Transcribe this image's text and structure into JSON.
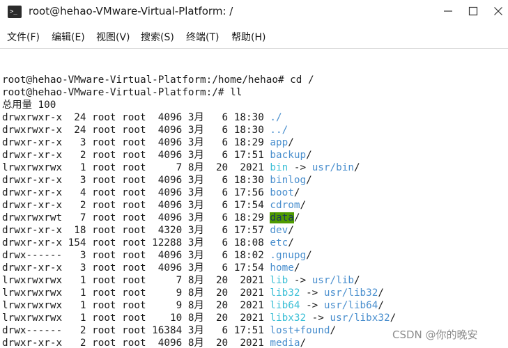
{
  "window": {
    "title": "root@hehao-VMware-Virtual-Platform: /",
    "icon": "terminal-icon",
    "controls": [
      "minimize-icon",
      "maximize-icon",
      "close-icon"
    ]
  },
  "menu": [
    {
      "label": "文件(F)"
    },
    {
      "label": "编辑(E)"
    },
    {
      "label": "视图(V)"
    },
    {
      "label": "搜索(S)"
    },
    {
      "label": "终端(T)"
    },
    {
      "label": "帮助(H)"
    }
  ],
  "terminal": {
    "lines": [
      {
        "text": "root@hehao-VMware-Virtual-Platform:/home/hehao# cd /"
      },
      {
        "text": "root@hehao-VMware-Virtual-Platform:/# ll"
      },
      {
        "text": "总用量 100"
      }
    ],
    "entries": [
      {
        "meta": "drwxrwxr-x  24 root root  4096 3月   6 18:30 ",
        "name": "./",
        "kind": "dir",
        "suffix": "",
        "target": ""
      },
      {
        "meta": "drwxrwxr-x  24 root root  4096 3月   6 18:30 ",
        "name": "../",
        "kind": "dir",
        "suffix": "",
        "target": ""
      },
      {
        "meta": "drwxr-xr-x   3 root root  4096 3月   6 18:29 ",
        "name": "app",
        "kind": "dir",
        "suffix": "/",
        "target": ""
      },
      {
        "meta": "drwxr-xr-x   2 root root  4096 3月   6 17:51 ",
        "name": "backup",
        "kind": "dir",
        "suffix": "/",
        "target": ""
      },
      {
        "meta": "lrwxrwxrwx   1 root root     7 8月  20  2021 ",
        "name": "bin",
        "kind": "link",
        "suffix": " -> ",
        "target": "usr/bin"
      },
      {
        "meta": "drwxr-xr-x   3 root root  4096 3月   6 18:30 ",
        "name": "binlog",
        "kind": "dir",
        "suffix": "/",
        "target": ""
      },
      {
        "meta": "drwxr-xr-x   4 root root  4096 3月   6 17:56 ",
        "name": "boot",
        "kind": "dir",
        "suffix": "/",
        "target": ""
      },
      {
        "meta": "drwxr-xr-x   2 root root  4096 3月   6 17:54 ",
        "name": "cdrom",
        "kind": "dir",
        "suffix": "/",
        "target": ""
      },
      {
        "meta": "drwxrwxrwt   7 root root  4096 3月   6 18:29 ",
        "name": "data",
        "kind": "sticky",
        "suffix": "/",
        "target": ""
      },
      {
        "meta": "drwxr-xr-x  18 root root  4320 3月   6 17:57 ",
        "name": "dev",
        "kind": "dir",
        "suffix": "/",
        "target": ""
      },
      {
        "meta": "drwxr-xr-x 154 root root 12288 3月   6 18:08 ",
        "name": "etc",
        "kind": "dir",
        "suffix": "/",
        "target": ""
      },
      {
        "meta": "drwx------   3 root root  4096 3月   6 18:02 ",
        "name": ".gnupg",
        "kind": "dir",
        "suffix": "/",
        "target": ""
      },
      {
        "meta": "drwxr-xr-x   3 root root  4096 3月   6 17:54 ",
        "name": "home",
        "kind": "dir",
        "suffix": "/",
        "target": ""
      },
      {
        "meta": "lrwxrwxrwx   1 root root     7 8月  20  2021 ",
        "name": "lib",
        "kind": "link",
        "suffix": " -> ",
        "target": "usr/lib"
      },
      {
        "meta": "lrwxrwxrwx   1 root root     9 8月  20  2021 ",
        "name": "lib32",
        "kind": "link",
        "suffix": " -> ",
        "target": "usr/lib32"
      },
      {
        "meta": "lrwxrwxrwx   1 root root     9 8月  20  2021 ",
        "name": "lib64",
        "kind": "link",
        "suffix": " -> ",
        "target": "usr/lib64"
      },
      {
        "meta": "lrwxrwxrwx   1 root root    10 8月  20  2021 ",
        "name": "libx32",
        "kind": "link",
        "suffix": " -> ",
        "target": "usr/libx32"
      },
      {
        "meta": "drwx------   2 root root 16384 3月   6 17:51 ",
        "name": "lost+found",
        "kind": "dir",
        "suffix": "/",
        "target": ""
      },
      {
        "meta": "drwxr-xr-x   2 root root  4096 8月  20  2021 ",
        "name": "media",
        "kind": "dir",
        "suffix": "/",
        "target": ""
      }
    ]
  },
  "colors": {
    "directory": "#4a8fce",
    "symlink": "#3bbfd6",
    "sticky_bg": "#4f9a00",
    "text": "#1a1a1a"
  },
  "watermark": "CSDN @你的晚安"
}
